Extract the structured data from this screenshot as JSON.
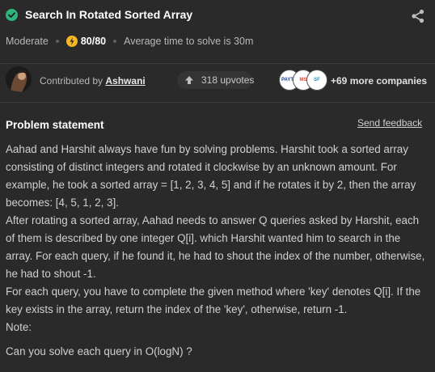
{
  "problem": {
    "title": "Search In Rotated Sorted Array",
    "difficulty": "Moderate",
    "score": "80/80",
    "avg_time": "Average time to solve is 30m"
  },
  "contributor": {
    "prefix": "Contributed by",
    "name": "Ashwani"
  },
  "upvotes": "318 upvotes",
  "companies": {
    "logos": [
      "PAYTM",
      "MS",
      "SF"
    ],
    "more": "+69 more companies"
  },
  "statement": {
    "heading": "Problem statement",
    "feedback": "Send feedback",
    "paragraphs": [
      "Aahad and Harshit always have fun by solving problems. Harshit took a sorted array consisting of distinct integers and rotated it clockwise by an unknown amount. For example, he took a sorted array = [1, 2, 3, 4, 5] and if he rotates it by 2, then the array becomes: [4, 5, 1, 2, 3].",
      "After rotating a sorted array, Aahad needs to answer Q queries asked by Harshit, each of them is described by one integer Q[i]. which Harshit wanted him to search in the array. For each query, if he found it, he had to shout the index of the number, otherwise, he had to shout -1.",
      "For each query, you have to complete the given method where 'key' denotes Q[i]. If the key exists in the array, return the index of the 'key', otherwise, return -1.",
      "Note:",
      "Can you solve each query in O(logN) ?"
    ]
  },
  "colors": {
    "background": "#2a2a2a",
    "success": "#2cb67d",
    "score_badge": "#f5b822"
  }
}
